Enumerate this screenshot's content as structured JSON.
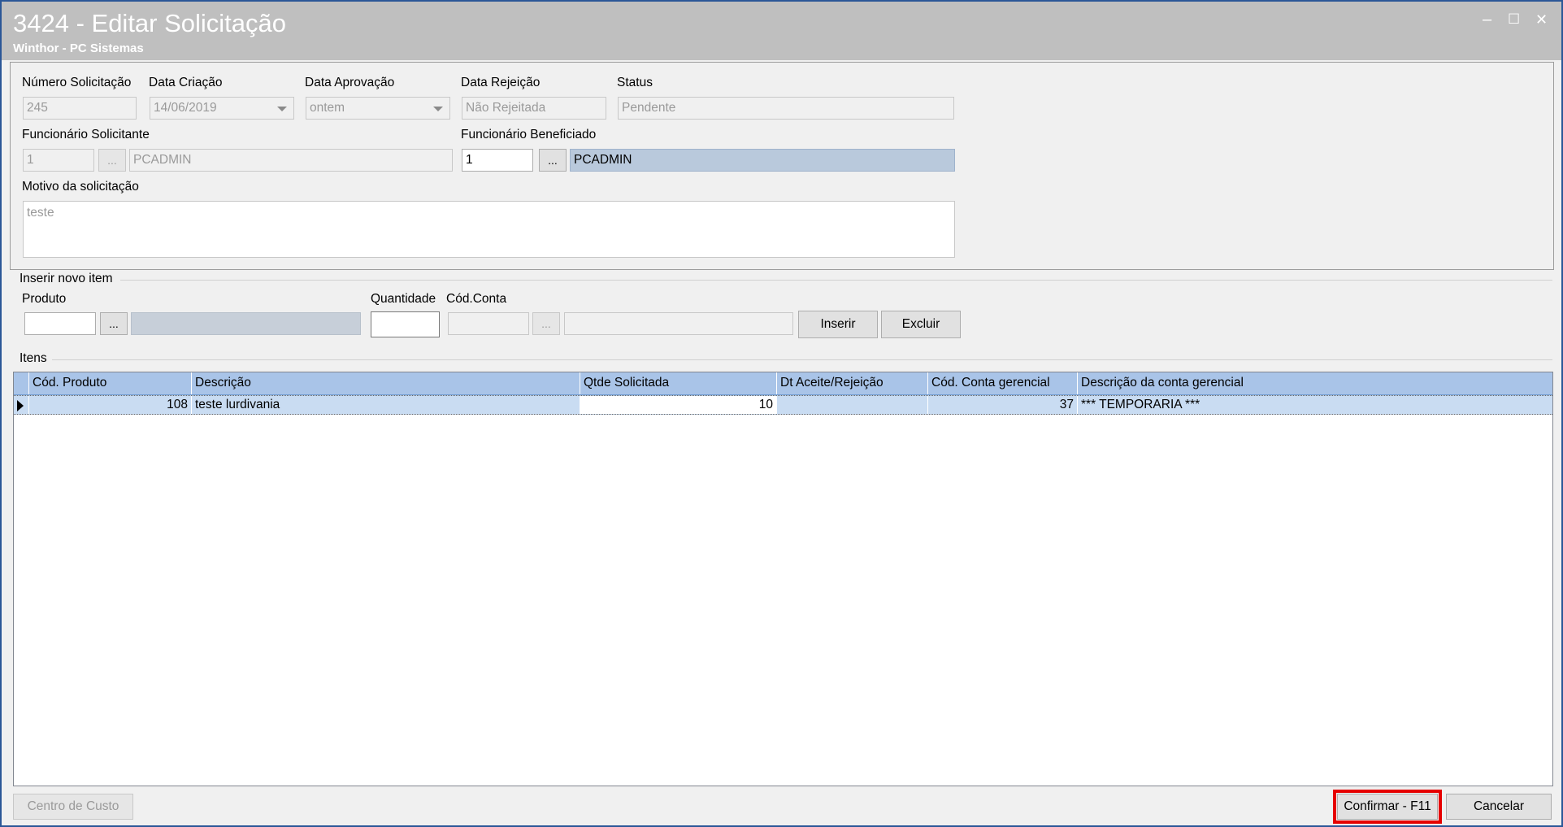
{
  "window": {
    "title": "3424 - Editar Solicitação",
    "subtitle": "Winthor - PC Sistemas",
    "minimize": "–",
    "maximize": "☐",
    "close": "✕"
  },
  "header": {
    "numero_label": "Número Solicitação",
    "numero_value": "245",
    "data_criacao_label": "Data Criação",
    "data_criacao_value": "14/06/2019",
    "data_aprovacao_label": "Data Aprovação",
    "data_aprovacao_value": "ontem",
    "data_rejeicao_label": "Data Rejeição",
    "data_rejeicao_value": "Não Rejeitada",
    "status_label": "Status",
    "status_value": "Pendente",
    "solicitante_label": "Funcionário Solicitante",
    "solicitante_code": "1",
    "solicitante_browse": "...",
    "solicitante_name": "PCADMIN",
    "beneficiado_label": "Funcionário Beneficiado",
    "beneficiado_code": "1",
    "beneficiado_browse": "...",
    "beneficiado_name": "PCADMIN",
    "motivo_label": "Motivo da solicitação",
    "motivo_value": "teste"
  },
  "insert": {
    "section_label": "Inserir novo item",
    "produto_label": "Produto",
    "produto_browse": "...",
    "quantidade_label": "Quantidade",
    "codconta_label": "Cód.Conta",
    "codconta_browse": "...",
    "inserir_button": "Inserir",
    "excluir_button": "Excluir"
  },
  "items": {
    "section_label": "Itens",
    "columns": [
      "Cód. Produto",
      "Descrição",
      "Qtde Solicitada",
      "Dt Aceite/Rejeição",
      "Cód. Conta gerencial",
      "Descrição da conta gerencial"
    ],
    "rows": [
      {
        "cod_produto": "108",
        "descricao": "teste lurdivania",
        "qtde": "10",
        "dt_aceite": "",
        "cod_conta": "37",
        "desc_conta": "*** TEMPORARIA ***"
      }
    ]
  },
  "footer": {
    "centro_custo_button": "Centro de Custo",
    "confirmar_button": "Confirmar - F11",
    "cancelar_button": "Cancelar"
  },
  "colors": {
    "title_bar": "#bfbfbf",
    "grid_header": "#a9c4e8",
    "selected_row": "#c9dcf2",
    "highlight_outline": "#e60000"
  }
}
